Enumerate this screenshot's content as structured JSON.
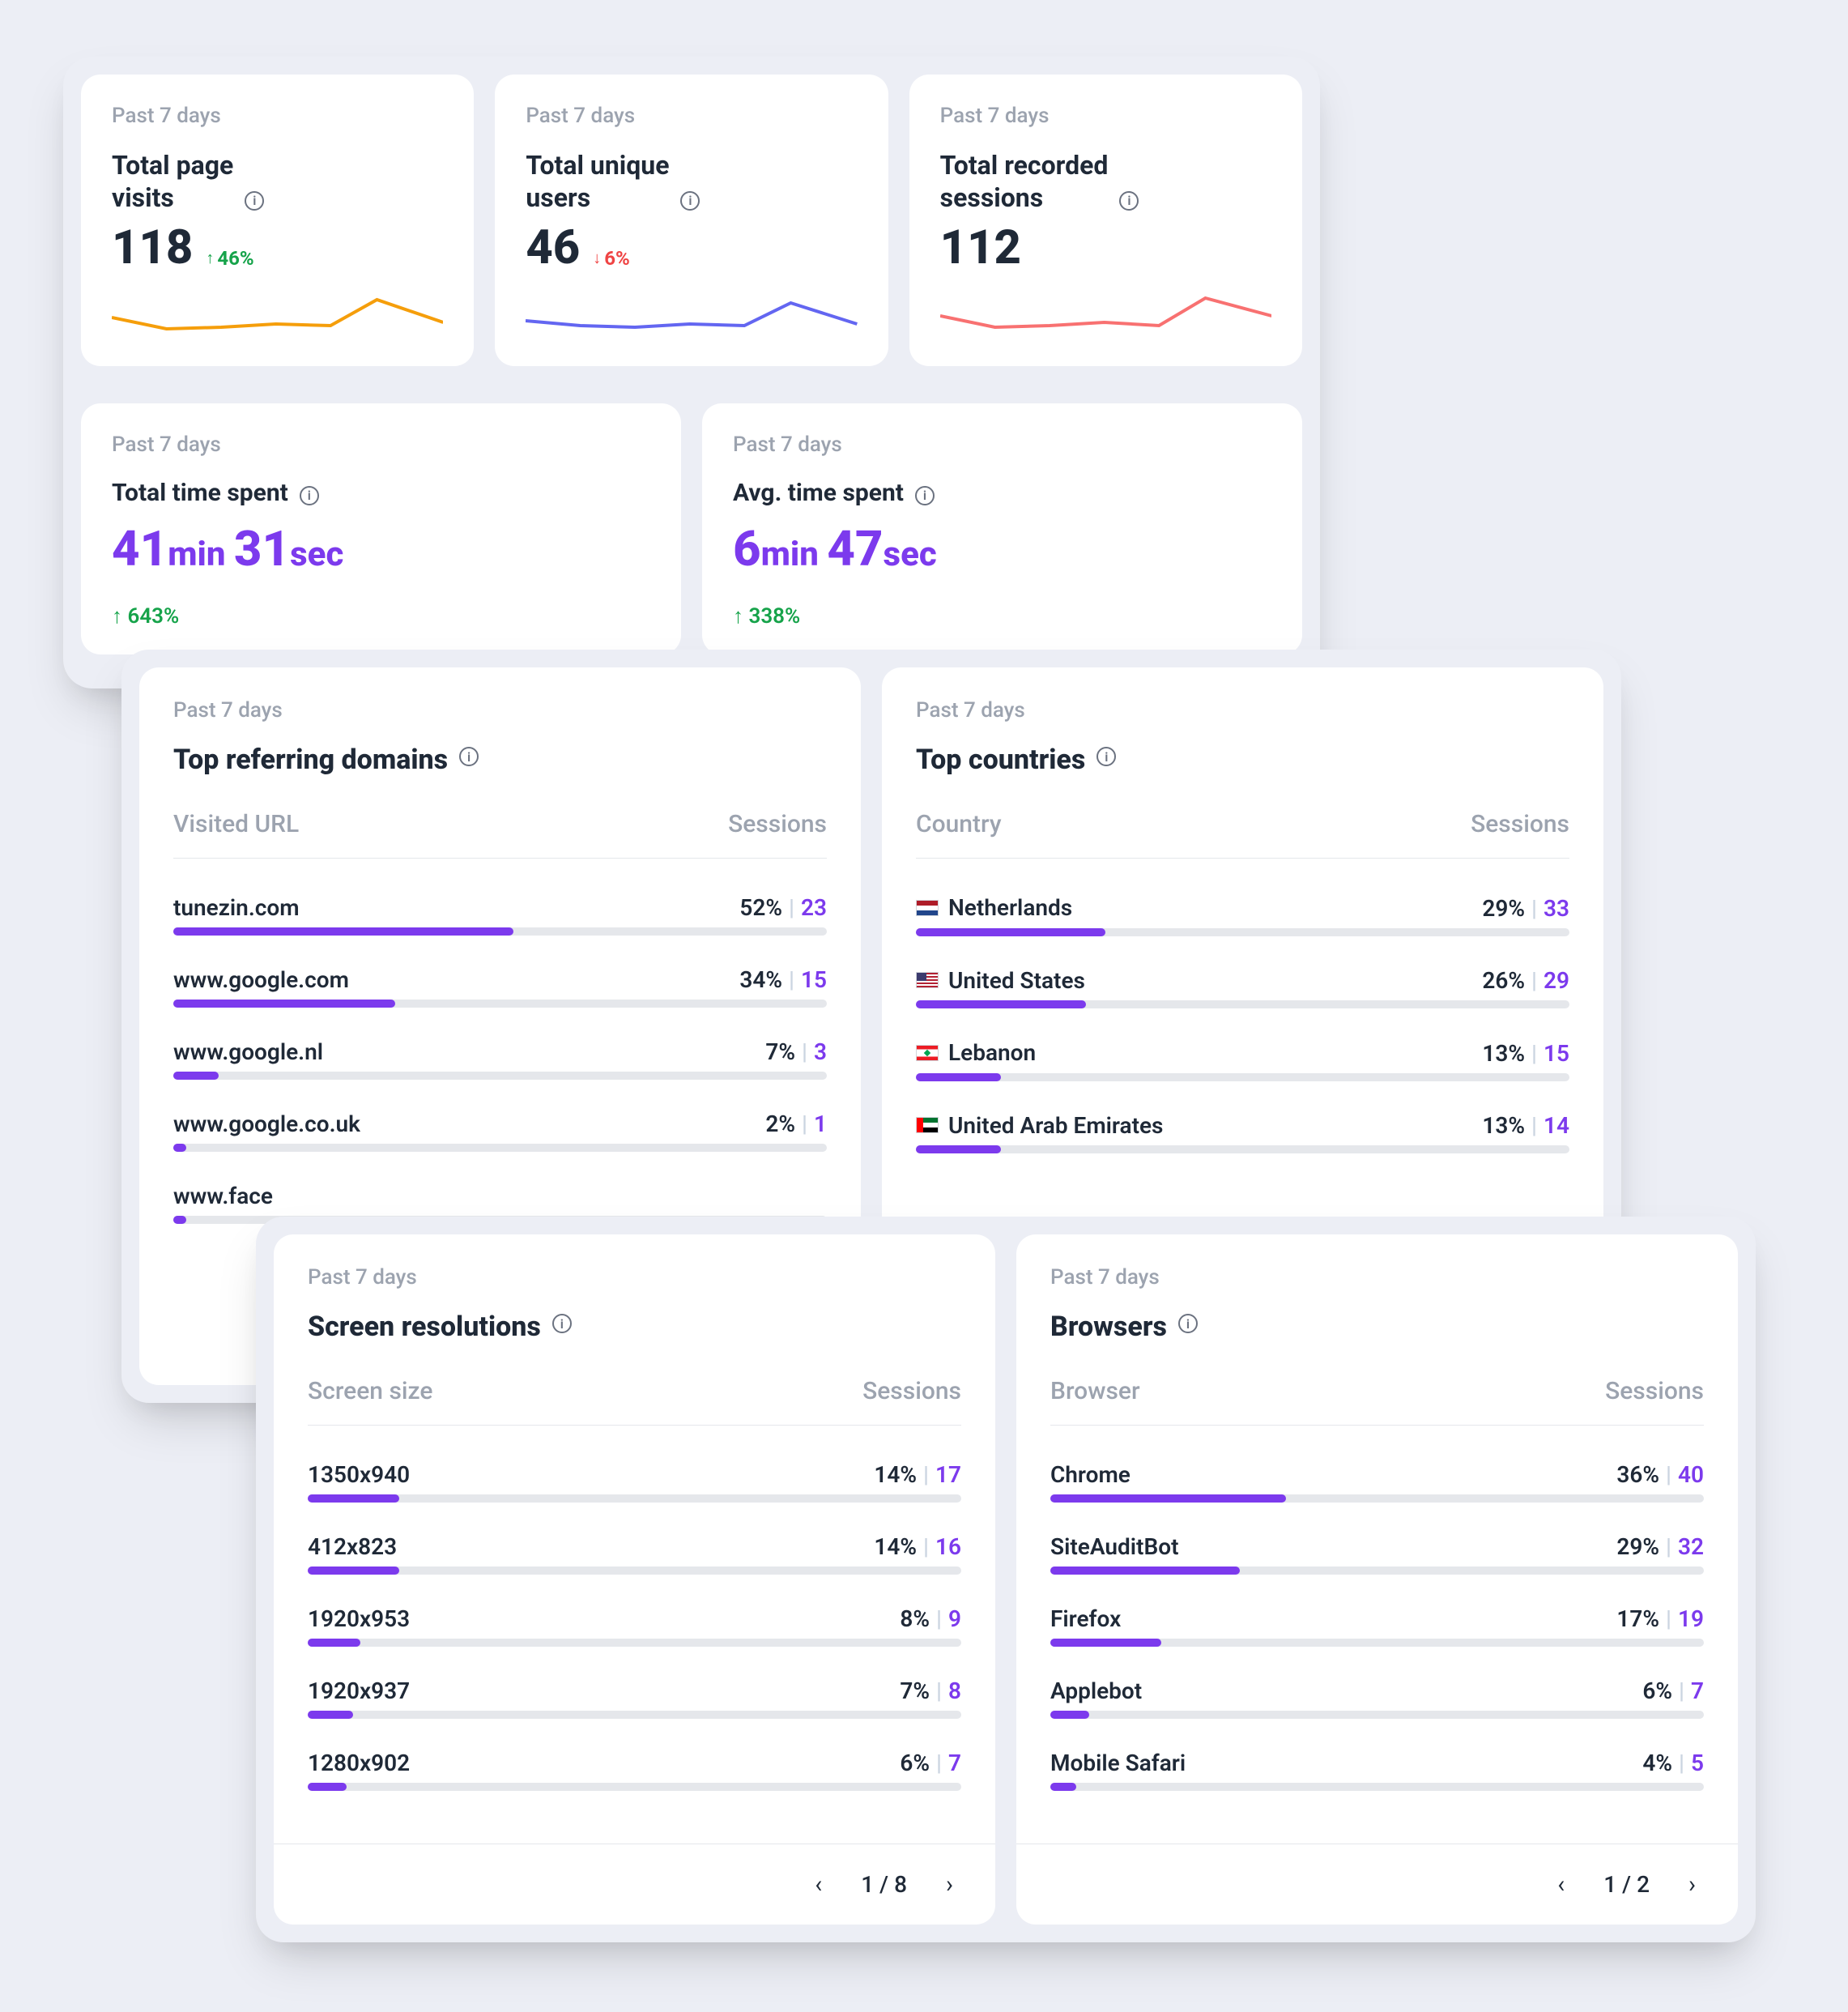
{
  "period_label": "Past 7 days",
  "metrics": {
    "page_visits": {
      "title_l1": "Total page",
      "title_l2": "visits",
      "value": "118",
      "delta": "46%",
      "dir": "up",
      "spark_color": "#f59e0b"
    },
    "unique_users": {
      "title_l1": "Total unique",
      "title_l2": "users",
      "value": "46",
      "delta": "6%",
      "dir": "down",
      "spark_color": "#6366f1"
    },
    "recorded": {
      "title_l1": "Total recorded",
      "title_l2": "sessions",
      "value": "112",
      "delta": "",
      "dir": "",
      "spark_color": "#f87171"
    }
  },
  "times": {
    "total": {
      "title": "Total time spent",
      "min": "41",
      "sec": "31",
      "delta": "643%"
    },
    "avg": {
      "title": "Avg. time spent",
      "min": "6",
      "sec": "47",
      "delta": "338%"
    }
  },
  "referring": {
    "title": "Top referring domains",
    "col_left": "Visited URL",
    "col_right": "Sessions",
    "rows": [
      {
        "name": "tunezin.com",
        "pct": "52%",
        "count": "23",
        "width": 52
      },
      {
        "name": "www.google.com",
        "pct": "34%",
        "count": "15",
        "width": 34
      },
      {
        "name": "www.google.nl",
        "pct": "7%",
        "count": "3",
        "width": 7
      },
      {
        "name": "www.google.co.uk",
        "pct": "2%",
        "count": "1",
        "width": 2
      },
      {
        "name": "www.face",
        "pct": "",
        "count": "",
        "width": 2
      }
    ]
  },
  "countries": {
    "title": "Top countries",
    "col_left": "Country",
    "col_right": "Sessions",
    "rows": [
      {
        "flag": "nl",
        "name": "Netherlands",
        "pct": "29%",
        "count": "33",
        "width": 29
      },
      {
        "flag": "us",
        "name": "United States",
        "pct": "26%",
        "count": "29",
        "width": 26
      },
      {
        "flag": "lb",
        "name": "Lebanon",
        "pct": "13%",
        "count": "15",
        "width": 13
      },
      {
        "flag": "ae",
        "name": "United Arab Emirates",
        "pct": "13%",
        "count": "14",
        "width": 13
      }
    ]
  },
  "resolutions": {
    "title": "Screen resolutions",
    "col_left": "Screen size",
    "col_right": "Sessions",
    "rows": [
      {
        "name": "1350x940",
        "pct": "14%",
        "count": "17",
        "width": 14
      },
      {
        "name": "412x823",
        "pct": "14%",
        "count": "16",
        "width": 14
      },
      {
        "name": "1920x953",
        "pct": "8%",
        "count": "9",
        "width": 8
      },
      {
        "name": "1920x937",
        "pct": "7%",
        "count": "8",
        "width": 7
      },
      {
        "name": "1280x902",
        "pct": "6%",
        "count": "7",
        "width": 6
      }
    ],
    "page": "1",
    "pages": "8"
  },
  "browsers": {
    "title": "Browsers",
    "col_left": "Browser",
    "col_right": "Sessions",
    "rows": [
      {
        "name": "Chrome",
        "pct": "36%",
        "count": "40",
        "width": 36
      },
      {
        "name": "SiteAuditBot",
        "pct": "29%",
        "count": "32",
        "width": 29
      },
      {
        "name": "Firefox",
        "pct": "17%",
        "count": "19",
        "width": 17
      },
      {
        "name": "Applebot",
        "pct": "6%",
        "count": "7",
        "width": 6
      },
      {
        "name": "Mobile Safari",
        "pct": "4%",
        "count": "5",
        "width": 4
      }
    ],
    "page": "1",
    "pages": "2"
  },
  "chart_data": [
    {
      "type": "line",
      "name": "Total page visits sparkline",
      "x": [
        0,
        1,
        2,
        3,
        4,
        5,
        6
      ],
      "values": [
        32,
        25,
        26,
        28,
        27,
        45,
        30
      ],
      "color": "#f59e0b"
    },
    {
      "type": "line",
      "name": "Total unique users sparkline",
      "x": [
        0,
        1,
        2,
        3,
        4,
        5,
        6
      ],
      "values": [
        30,
        28,
        27,
        29,
        28,
        42,
        30
      ],
      "color": "#6366f1"
    },
    {
      "type": "line",
      "name": "Total recorded sessions sparkline",
      "x": [
        0,
        1,
        2,
        3,
        4,
        5,
        6
      ],
      "values": [
        33,
        27,
        28,
        30,
        28,
        46,
        35
      ],
      "color": "#f87171"
    },
    {
      "type": "bar",
      "name": "Top referring domains",
      "categories": [
        "tunezin.com",
        "www.google.com",
        "www.google.nl",
        "www.google.co.uk"
      ],
      "values": [
        23,
        15,
        3,
        1
      ],
      "pct": [
        52,
        34,
        7,
        2
      ],
      "ylabel": "Sessions"
    },
    {
      "type": "bar",
      "name": "Top countries",
      "categories": [
        "Netherlands",
        "United States",
        "Lebanon",
        "United Arab Emirates"
      ],
      "values": [
        33,
        29,
        15,
        14
      ],
      "pct": [
        29,
        26,
        13,
        13
      ],
      "ylabel": "Sessions"
    },
    {
      "type": "bar",
      "name": "Screen resolutions",
      "categories": [
        "1350x940",
        "412x823",
        "1920x953",
        "1920x937",
        "1280x902"
      ],
      "values": [
        17,
        16,
        9,
        8,
        7
      ],
      "pct": [
        14,
        14,
        8,
        7,
        6
      ],
      "ylabel": "Sessions"
    },
    {
      "type": "bar",
      "name": "Browsers",
      "categories": [
        "Chrome",
        "SiteAuditBot",
        "Firefox",
        "Applebot",
        "Mobile Safari"
      ],
      "values": [
        40,
        32,
        19,
        7,
        5
      ],
      "pct": [
        36,
        29,
        17,
        6,
        4
      ],
      "ylabel": "Sessions"
    }
  ]
}
